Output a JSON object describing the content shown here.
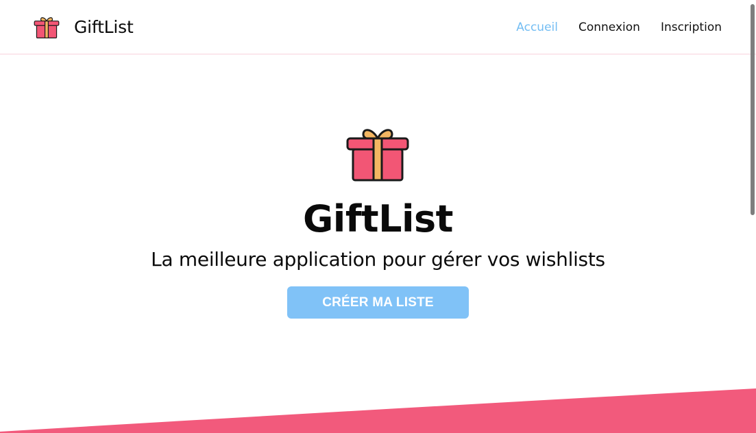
{
  "navbar": {
    "brand": {
      "name": "GiftList",
      "icon": "gift-icon"
    },
    "links": [
      {
        "label": "Accueil",
        "active": true
      },
      {
        "label": "Connexion",
        "active": false
      },
      {
        "label": "Inscription",
        "active": false
      }
    ]
  },
  "hero": {
    "icon": "gift-icon",
    "title": "GiftList",
    "subtitle": "La meilleure application pour gérer vos wishlists",
    "cta_label": "CRÉER MA LISTE"
  },
  "colors": {
    "accent": "#80c2f7",
    "active_link": "#73bdf3",
    "gift_box": "#f25675",
    "gift_ribbon": "#f3b662",
    "wave": "#f25a7c"
  }
}
